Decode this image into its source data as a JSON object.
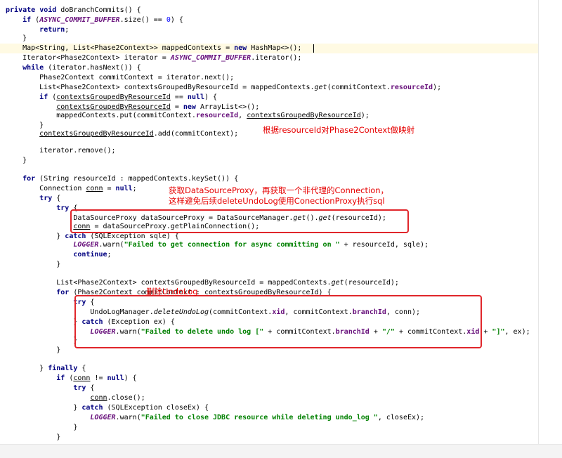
{
  "code_lines": [
    "private void doBranchCommits() {",
    "    if (ASYNC_COMMIT_BUFFER.size() == 0) {",
    "        return;",
    "    }",
    "    Map<String, List<Phase2Context>> mappedContexts = new HashMap<>();",
    "    Iterator<Phase2Context> iterator = ASYNC_COMMIT_BUFFER.iterator();",
    "    while (iterator.hasNext()) {",
    "        Phase2Context commitContext = iterator.next();",
    "        List<Phase2Context> contextsGroupedByResourceId = mappedContexts.get(commitContext.resourceId);",
    "        if (contextsGroupedByResourceId == null) {",
    "            contextsGroupedByResourceId = new ArrayList<>();",
    "            mappedContexts.put(commitContext.resourceId, contextsGroupedByResourceId);",
    "        }",
    "        contextsGroupedByResourceId.add(commitContext);",
    "",
    "        iterator.remove();",
    "    }",
    "",
    "    for (String resourceId : mappedContexts.keySet()) {",
    "        Connection conn = null;",
    "        try {",
    "            try {",
    "                DataSourceProxy dataSourceProxy = DataSourceManager.get().get(resourceId);",
    "                conn = dataSourceProxy.getPlainConnection();",
    "            } catch (SQLException sqle) {",
    "                LOGGER.warn(\"Failed to get connection for async committing on \" + resourceId, sqle);",
    "                continue;",
    "            }",
    "",
    "            List<Phase2Context> contextsGroupedByResourceId = mappedContexts.get(resourceId);",
    "            for (Phase2Context commitContext : contextsGroupedByResourceId) {",
    "                try {",
    "                    UndoLogManager.deleteUndoLog(commitContext.xid, commitContext.branchId, conn);",
    "                } catch (Exception ex) {",
    "                    LOGGER.warn(\"Failed to delete undo log [\" + commitContext.branchId + \"/\" + commitContext.xid + \"]\", ex);",
    "                }",
    "            }",
    "",
    "        } finally {",
    "            if (conn != null) {",
    "                try {",
    "                    conn.close();",
    "                } catch (SQLException closeEx) {",
    "                    LOGGER.warn(\"Failed to close JDBC resource while deleting undo_log \", closeEx);",
    "                }",
    "            }",
    "        }"
  ],
  "annotations": {
    "mapping": "根据resourceId对Phase2Context做映射",
    "proxy_line1": "获取DataSourceProxy，再获取一个非代理的Connection，",
    "proxy_line2": "这样避免后续deleteUndoLog使用ConectionProxy执行sql",
    "delete_undolog": "删除UndoLog"
  },
  "colors": {
    "keyword": "#000080",
    "string": "#008000",
    "static_field": "#660e7a",
    "number": "#0000ff",
    "annotation_red": "#e60000",
    "caret_line_bg": "#fffae3"
  }
}
